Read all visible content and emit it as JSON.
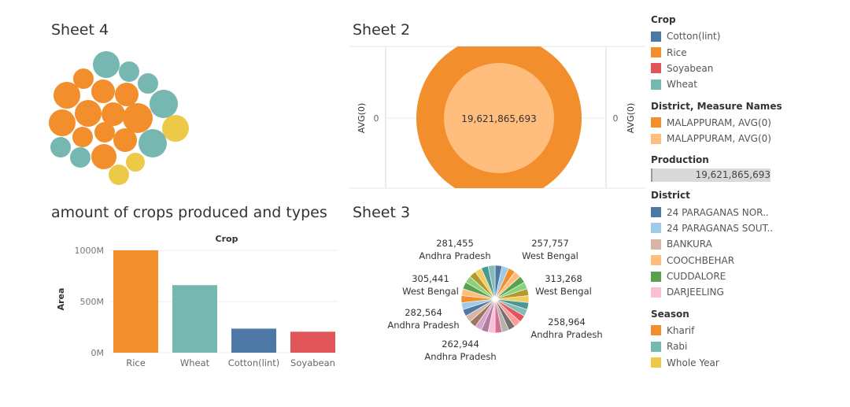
{
  "titles": {
    "sheet4": "Sheet 4",
    "sheet2": "Sheet 2",
    "bar_chart": "amount of crops produced and types",
    "sheet3": "Sheet 3"
  },
  "colors": {
    "rice": "#f28e2b",
    "wheat": "#76b7b2",
    "cotton": "#4e79a7",
    "soyabean": "#e15759",
    "whole_year": "#edc948",
    "avg_light": "#ffbe7d",
    "avg_dark": "#f28e2b"
  },
  "chart_data": [
    {
      "type": "bubble",
      "title": "Sheet 4",
      "color_by": "Season",
      "circles": [
        {
          "season": "Rabi"
        },
        {
          "season": "Kharif"
        },
        {
          "season": "Rabi"
        },
        {
          "season": "Rabi"
        },
        {
          "season": "Kharif"
        },
        {
          "season": "Kharif"
        },
        {
          "season": "Kharif"
        },
        {
          "season": "Rabi"
        },
        {
          "season": "Kharif"
        },
        {
          "season": "Kharif"
        },
        {
          "season": "Kharif"
        },
        {
          "season": "Kharif"
        },
        {
          "season": "Kharif"
        },
        {
          "season": "Whole Year"
        },
        {
          "season": "Kharif"
        },
        {
          "season": "Kharif"
        },
        {
          "season": "Kharif"
        },
        {
          "season": "Rabi"
        },
        {
          "season": "Rabi"
        },
        {
          "season": "Rabi"
        },
        {
          "season": "Kharif"
        },
        {
          "season": "Whole Year"
        },
        {
          "season": "Whole Year"
        }
      ]
    },
    {
      "type": "dual-axis-circle",
      "title": "Sheet 2",
      "left_axis": {
        "label": "AVG(0)",
        "tick": "0"
      },
      "right_axis": {
        "label": "AVG(0)",
        "tick": "0"
      },
      "center_label": "19,621,865,693",
      "district": "MALAPPURAM",
      "value": 19621865693
    },
    {
      "type": "bar",
      "title": "amount of crops produced and types",
      "column_header": "Crop",
      "ylabel": "Area",
      "ylim": [
        0,
        1000000000
      ],
      "yticks": [
        {
          "value": 1000000000,
          "label": "1000M"
        },
        {
          "value": 500000000,
          "label": "500M"
        },
        {
          "value": 0,
          "label": "0M"
        }
      ],
      "categories": [
        "Rice",
        "Wheat",
        "Cotton(lint)",
        "Soyabean"
      ],
      "values": [
        1000000000,
        660000000,
        235000000,
        205000000
      ],
      "color_keys": [
        "rice",
        "wheat",
        "cotton",
        "soyabean"
      ]
    },
    {
      "type": "pie",
      "title": "Sheet 3",
      "slice_count": 30,
      "labels": [
        {
          "value": "281,455",
          "state": "Andhra Pradesh"
        },
        {
          "value": "257,757",
          "state": "West Bengal"
        },
        {
          "value": "305,441",
          "state": "West Bengal"
        },
        {
          "value": "313,268",
          "state": "West Bengal"
        },
        {
          "value": "282,564",
          "state": "Andhra Pradesh"
        },
        {
          "value": "258,964",
          "state": "Andhra Pradesh"
        },
        {
          "value": "262,944",
          "state": "Andhra Pradesh"
        }
      ],
      "palette": [
        "#4e79a7",
        "#a0cbe8",
        "#f28e2b",
        "#ffbe7d",
        "#59a14f",
        "#8cd17d",
        "#b6992d",
        "#f1ce63",
        "#499894",
        "#86bcb6",
        "#e15759",
        "#ff9d9a",
        "#79706e",
        "#bab0ac",
        "#d37295",
        "#fabfd2",
        "#b07aa1",
        "#d4a6c8",
        "#9d7660",
        "#d7b5a6"
      ]
    }
  ],
  "legends": {
    "crop": {
      "title": "Crop",
      "items": [
        {
          "label": "Cotton(lint)",
          "color": "#4e79a7"
        },
        {
          "label": "Rice",
          "color": "#f28e2b"
        },
        {
          "label": "Soyabean",
          "color": "#e15759"
        },
        {
          "label": "Wheat",
          "color": "#76b7b2"
        }
      ]
    },
    "district_measure": {
      "title": "District, Measure Names",
      "items": [
        {
          "label": "MALAPPURAM, AVG(0)",
          "color": "#f28e2b"
        },
        {
          "label": "MALAPPURAM, AVG(0)",
          "color": "#ffbe7d"
        }
      ]
    },
    "production": {
      "title": "Production",
      "value": "19,621,865,693"
    },
    "district": {
      "title": "District",
      "items": [
        {
          "label": "24 PARAGANAS NOR..",
          "color": "#4e79a7"
        },
        {
          "label": "24 PARAGANAS SOUT..",
          "color": "#a0cbe8"
        },
        {
          "label": "BANKURA",
          "color": "#d7b5a6"
        },
        {
          "label": "COOCHBEHAR",
          "color": "#ffbe7d"
        },
        {
          "label": "CUDDALORE",
          "color": "#59a14f"
        },
        {
          "label": "DARJEELING",
          "color": "#fabfd2"
        }
      ]
    },
    "season": {
      "title": "Season",
      "items": [
        {
          "label": "Kharif",
          "color": "#f28e2b"
        },
        {
          "label": "Rabi",
          "color": "#76b7b2"
        },
        {
          "label": "Whole Year",
          "color": "#edc948"
        }
      ]
    }
  }
}
